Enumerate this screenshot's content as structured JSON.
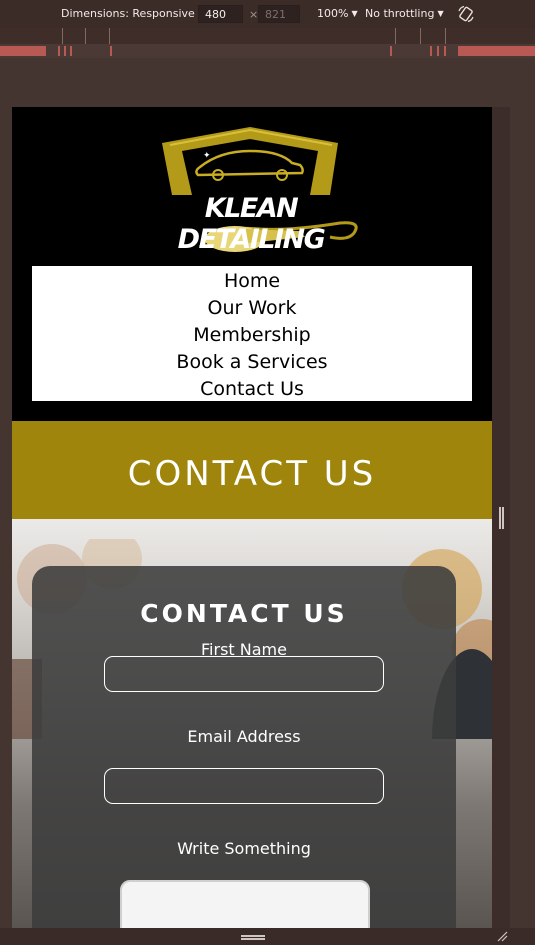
{
  "devtools": {
    "dimensions_label": "Dimensions: Responsive",
    "width_value": "480",
    "times": "×",
    "height_value": "821",
    "zoom": "100%",
    "throttling": "No throttling",
    "rotate_icon": "rotate-icon"
  },
  "site": {
    "logo_text": "KLEAN DETAILING",
    "nav": [
      "Home",
      "Our Work",
      "Membership",
      "Book a Services",
      "Contact Us"
    ],
    "banner_title": "CONTACT US",
    "brand_color": "#9f850b"
  },
  "form": {
    "title": "CONTACT US",
    "first_name_label": "First Name",
    "email_label": "Email Address",
    "message_label": "Write Something"
  }
}
